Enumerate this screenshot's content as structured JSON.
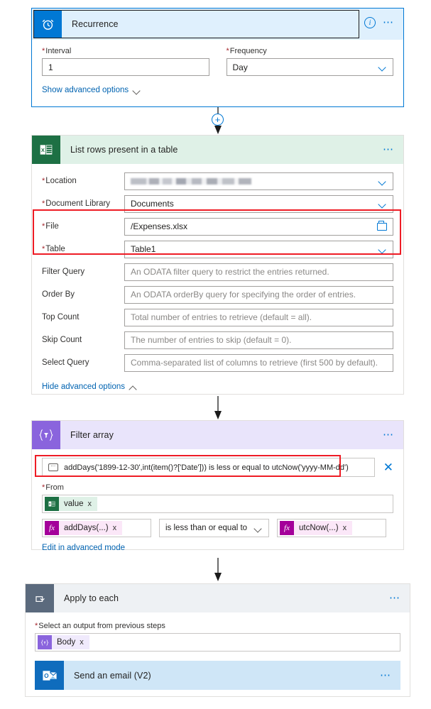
{
  "flow": {
    "steps": [
      {
        "id": "recurrence",
        "title": "Recurrence",
        "icon": "alarm-clock-icon",
        "info_icon": "info-icon",
        "menu_icon": "ellipsis-menu",
        "fields": [
          {
            "label": "Interval",
            "required": true,
            "value": "1"
          },
          {
            "label": "Frequency",
            "required": true,
            "value": "Day",
            "control": "dropdown"
          }
        ],
        "advanced_link": "Show advanced options"
      },
      {
        "id": "list-rows-present-in-a-table",
        "title": "List rows present in a table",
        "icon": "excel-icon",
        "menu_icon": "ellipsis-menu",
        "fields": [
          {
            "label": "Location",
            "required": true,
            "value": "",
            "redacted": true,
            "control": "dropdown"
          },
          {
            "label": "Document Library",
            "required": true,
            "value": "Documents",
            "control": "dropdown"
          },
          {
            "label": "File",
            "required": true,
            "value": "/Expenses.xlsx",
            "control": "folder-picker"
          },
          {
            "label": "Table",
            "required": true,
            "value": "Table1",
            "control": "dropdown"
          },
          {
            "label": "Filter Query",
            "required": false,
            "value": "",
            "placeholder": "An ODATA filter query to restrict the entries returned."
          },
          {
            "label": "Order By",
            "required": false,
            "value": "",
            "placeholder": "An ODATA orderBy query for specifying the order of entries."
          },
          {
            "label": "Top Count",
            "required": false,
            "value": "",
            "placeholder": "Total number of entries to retrieve (default = all)."
          },
          {
            "label": "Skip Count",
            "required": false,
            "value": "",
            "placeholder": "The number of entries to skip (default = 0)."
          },
          {
            "label": "Select Query",
            "required": false,
            "value": "",
            "placeholder": "Comma-separated list of columns to retrieve (first 500 by default)."
          }
        ],
        "advanced_link": "Hide advanced options"
      },
      {
        "id": "filter-array",
        "title": "Filter array",
        "icon": "filter-array-icon",
        "menu_icon": "ellipsis-menu",
        "expression_summary": "addDays('1899-12-30',int(item()?['Date'])) is less or equal to utcNow('yyyy-MM-dd')",
        "from_label": "From",
        "from_required": true,
        "from_token": {
          "text": "value",
          "icon": "excel-token-icon",
          "remove": "x"
        },
        "condition": {
          "left_token": {
            "text": "addDays(...)",
            "icon": "fx-icon",
            "remove": "x"
          },
          "operator": "is less than or equal to",
          "right_token": {
            "text": "utcNow(...)",
            "icon": "fx-icon",
            "remove": "x"
          }
        },
        "advanced_link": "Edit in advanced mode"
      },
      {
        "id": "apply-to-each",
        "title": "Apply to each",
        "icon": "loop-icon",
        "menu_icon": "ellipsis-menu",
        "select_label": "Select an output from previous steps",
        "select_required": true,
        "select_token": {
          "text": "Body",
          "icon": "filter-array-token-icon",
          "remove": "x"
        },
        "nested": {
          "id": "send-an-email-v2",
          "title": "Send an email (V2)",
          "icon": "outlook-icon",
          "menu_icon": "ellipsis-menu"
        }
      }
    ],
    "connectors": {
      "add_step_glyph": "+"
    }
  },
  "colors": {
    "accent_blue": "#0078d4",
    "recurrence_header": "#dff0fd",
    "excel_green": "#1d7044",
    "excel_header": "#dff1e7",
    "purple": "#8a64dd",
    "filter_header": "#e9e4fb",
    "gray_icon": "#5b6a7d",
    "apply_header": "#eef1f4",
    "outlook_blue": "#0f6cbd",
    "email_header": "#cfe6f7",
    "highlight_red": "#ee1c25",
    "required_red": "#a4262c",
    "fx_magenta": "#a4009a"
  }
}
